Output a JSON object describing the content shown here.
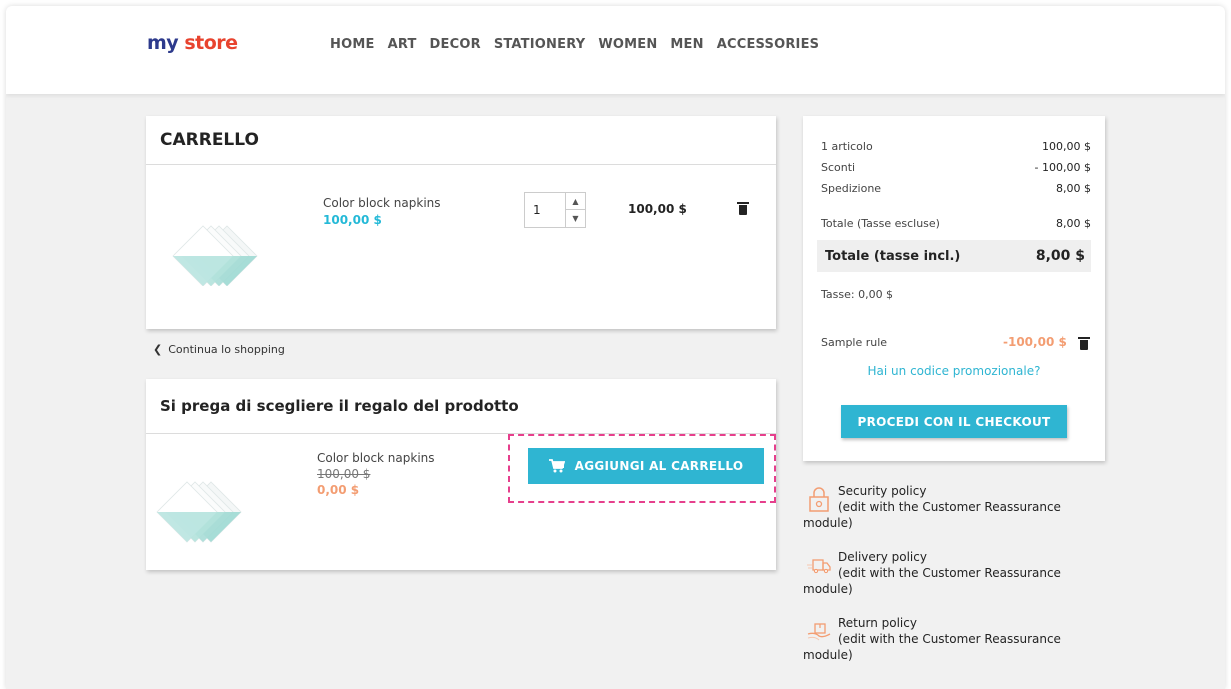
{
  "header": {
    "logo_part1": "my ",
    "logo_part2": "store",
    "nav": [
      "HOME",
      "ART",
      "DECOR",
      "STATIONERY",
      "WOMEN",
      "MEN",
      "ACCESSORIES"
    ]
  },
  "cart": {
    "title": "CARRELLO",
    "item": {
      "name": "Color block napkins",
      "price": "100,00 $",
      "quantity": "1",
      "total": "100,00 $"
    }
  },
  "continue_label": "Continua lo shopping",
  "gift": {
    "title": "Si prega di scegliere il regalo del prodotto",
    "item": {
      "name": "Color block napkins",
      "old_price": "100,00 $",
      "new_price": "0,00 $"
    },
    "add_button": "AGGIUNGI AL CARRELLO"
  },
  "summary": {
    "rows": [
      {
        "label": "1 articolo",
        "value": "100,00 $"
      },
      {
        "label": "Sconti",
        "value": "- 100,00 $"
      },
      {
        "label": "Spedizione",
        "value": "8,00 $"
      }
    ],
    "subtotal": {
      "label": "Totale (Tasse escluse)",
      "value": "8,00 $"
    },
    "total": {
      "label": "Totale (tasse incl.)",
      "value": "8,00 $"
    },
    "taxes": "Tasse: 0,00 $",
    "rule": {
      "name": "Sample rule",
      "value": "-100,00 $"
    },
    "promo_link": "Hai un codice promozionale?",
    "checkout_button": "PROCEDI CON IL CHECKOUT"
  },
  "reassurance": [
    {
      "title": "Security policy",
      "line2": "(edit with the Customer Reassurance",
      "line3": "module)"
    },
    {
      "title": "Delivery policy",
      "line2": "(edit with the Customer Reassurance",
      "line3": "module)"
    },
    {
      "title": "Return policy",
      "line2": "(edit with the Customer Reassurance",
      "line3": "module)"
    }
  ],
  "colors": {
    "accent": "#2fb5d2",
    "price_blue": "#24b9d7",
    "discount_orange": "#f39d72",
    "dashed_highlight": "#e63f8c"
  }
}
